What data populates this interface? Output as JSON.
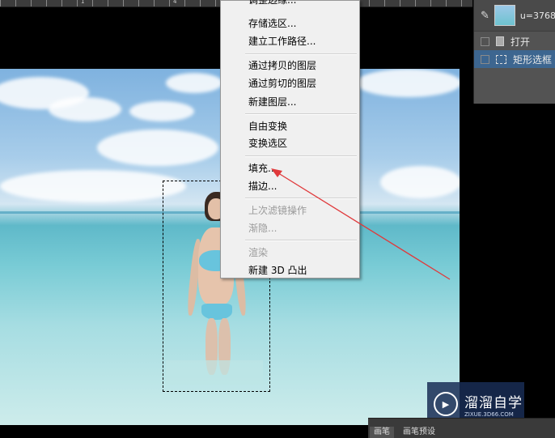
{
  "ruler": {
    "numbers": [
      "1",
      "4"
    ]
  },
  "context_menu": {
    "items": [
      {
        "label": "调整边缘...",
        "disabled": false
      },
      {
        "label": "存储选区...",
        "disabled": false
      },
      {
        "label": "建立工作路径...",
        "disabled": false
      },
      {
        "label": "通过拷贝的图层",
        "disabled": false
      },
      {
        "label": "通过剪切的图层",
        "disabled": false
      },
      {
        "label": "新建图层...",
        "disabled": false
      },
      {
        "label": "自由变换",
        "disabled": false
      },
      {
        "label": "变换选区",
        "disabled": false
      },
      {
        "label": "填充...",
        "disabled": false
      },
      {
        "label": "描边...",
        "disabled": false
      },
      {
        "label": "上次滤镜操作",
        "disabled": true
      },
      {
        "label": "渐隐...",
        "disabled": true
      },
      {
        "label": "渲染",
        "disabled": true
      },
      {
        "label": "新建 3D 凸出",
        "disabled": false
      }
    ]
  },
  "history_panel": {
    "snapshot_label": "u=3768",
    "steps": [
      "打开",
      "矩形选框"
    ]
  },
  "bottom_panel": {
    "tabs": [
      "画笔",
      "画笔预设"
    ]
  },
  "watermark": {
    "name": "溜溜自学",
    "url": "ZIXUE.3D66.COM"
  },
  "colors": {
    "menu_bg": "#f0f0f0",
    "selected_row": "#3d6690",
    "arrow": "#e0393b"
  }
}
